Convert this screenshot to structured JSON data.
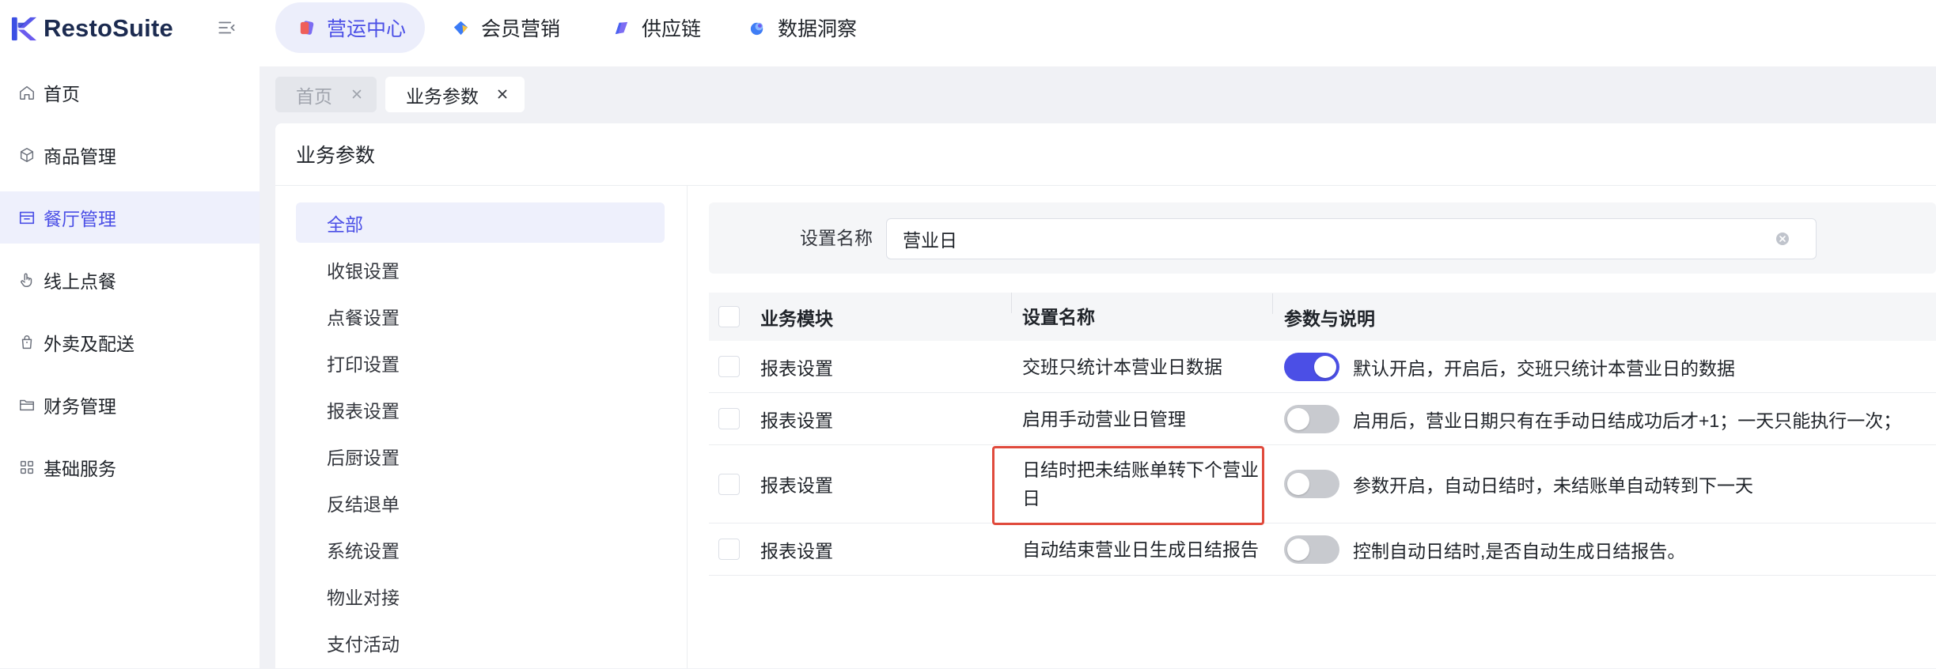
{
  "app": {
    "logo_text": "RestoSuite",
    "logo_icon": "restosuite-logo-icon"
  },
  "colors": {
    "primary": "#4b4fe6",
    "active_bg": "#eef0fc",
    "toggle_off": "#c8cacf",
    "highlight": "#e04a3c"
  },
  "top_nav": {
    "items": [
      {
        "label": "营运中心",
        "icon": "operations-icon",
        "active": true
      },
      {
        "label": "会员营销",
        "icon": "membership-icon",
        "active": false
      },
      {
        "label": "供应链",
        "icon": "supply-chain-icon",
        "active": false
      },
      {
        "label": "数据洞察",
        "icon": "data-insight-icon",
        "active": false
      }
    ]
  },
  "sidebar": {
    "items": [
      {
        "label": "首页",
        "icon": "home-icon",
        "active": false
      },
      {
        "label": "商品管理",
        "icon": "cube-icon",
        "active": false
      },
      {
        "label": "餐厅管理",
        "icon": "store-icon",
        "active": true
      },
      {
        "label": "线上点餐",
        "icon": "pointer-hand-icon",
        "active": false
      },
      {
        "label": "外卖及配送",
        "icon": "bag-icon",
        "active": false
      },
      {
        "label": "财务管理",
        "icon": "folder-icon",
        "active": false
      },
      {
        "label": "基础服务",
        "icon": "grid-icon",
        "active": false
      }
    ]
  },
  "tabs": [
    {
      "label": "首页",
      "active": false
    },
    {
      "label": "业务参数",
      "active": true
    }
  ],
  "page": {
    "title": "业务参数"
  },
  "categories": {
    "items": [
      {
        "label": "全部",
        "active": true
      },
      {
        "label": "收银设置",
        "active": false
      },
      {
        "label": "点餐设置",
        "active": false
      },
      {
        "label": "打印设置",
        "active": false
      },
      {
        "label": "报表设置",
        "active": false
      },
      {
        "label": "后厨设置",
        "active": false
      },
      {
        "label": "反结退单",
        "active": false
      },
      {
        "label": "系统设置",
        "active": false
      },
      {
        "label": "物业对接",
        "active": false
      },
      {
        "label": "支付活动",
        "active": false
      }
    ]
  },
  "search": {
    "label": "设置名称",
    "value": "营业日",
    "clear_icon": "clear-icon"
  },
  "table": {
    "headers": {
      "module": "业务模块",
      "name": "设置名称",
      "description": "参数与说明"
    },
    "rows": [
      {
        "module": "报表设置",
        "name": "交班只统计本营业日数据",
        "enabled": true,
        "description": "默认开启，开启后，交班只统计本营业日的数据"
      },
      {
        "module": "报表设置",
        "name": "启用手动营业日管理",
        "enabled": false,
        "description": "启用后，营业日期只有在手动日结成功后才+1；一天只能执行一次；"
      },
      {
        "module": "报表设置",
        "name": "日结时把未结账单转下个营业日",
        "enabled": false,
        "description": "参数开启，自动日结时，未结账单自动转到下一天"
      },
      {
        "module": "报表设置",
        "name": "自动结束营业日生成日结报告",
        "enabled": false,
        "description": "控制自动日结时,是否自动生成日结报告。"
      }
    ]
  },
  "highlight": {
    "row_index": 2,
    "column": "name"
  }
}
